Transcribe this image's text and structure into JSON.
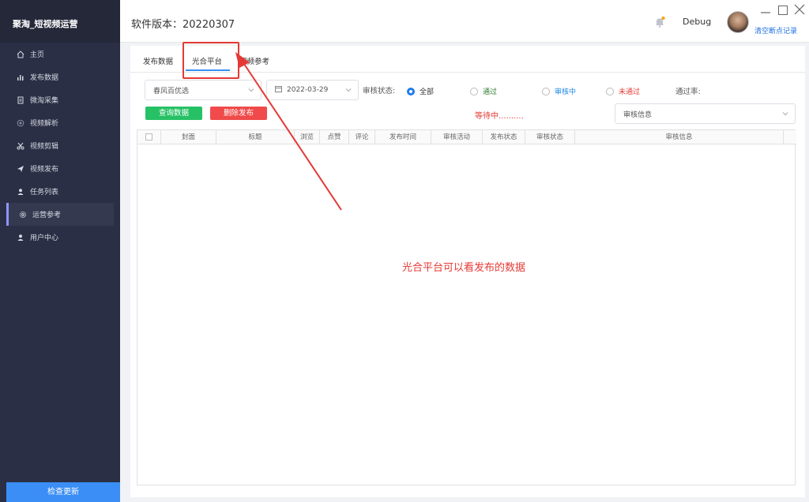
{
  "app": {
    "title": "聚淘_短视频运营",
    "version_label": "软件版本：20220307",
    "user": "Debug",
    "clear_link": "清空断点记录"
  },
  "sidebar": {
    "items": [
      {
        "label": "主页",
        "icon": "home-icon"
      },
      {
        "label": "发布数据",
        "icon": "bar-chart-icon"
      },
      {
        "label": "微淘采集",
        "icon": "document-icon"
      },
      {
        "label": "视频解析",
        "icon": "circle-icon"
      },
      {
        "label": "视频剪辑",
        "icon": "scissors-icon"
      },
      {
        "label": "视频发布",
        "icon": "send-icon"
      },
      {
        "label": "任务列表",
        "icon": "user-icon"
      },
      {
        "label": "运营参考",
        "icon": "gear-icon",
        "active": true
      },
      {
        "label": "用户中心",
        "icon": "user-icon"
      }
    ],
    "update_button": "检查更新"
  },
  "tabs": [
    {
      "label": "发布数据"
    },
    {
      "label": "光合平台",
      "active": true
    },
    {
      "label": "视频参考"
    }
  ],
  "filters": {
    "account": "春风百优选",
    "date": "2022-03-29",
    "status_label": "审核状态:",
    "radios": [
      {
        "label": "全部",
        "checked": true,
        "color": "#333333"
      },
      {
        "label": "通过",
        "checked": false,
        "color": "#2e7d32"
      },
      {
        "label": "审核中",
        "checked": false,
        "color": "#1e88e5"
      },
      {
        "label": "未通过",
        "checked": false,
        "color": "#e53935"
      }
    ],
    "pass_rate_label": "通过率:",
    "query_button": "查询数据",
    "delete_button": "删除发布",
    "waiting_text": "等待中..........",
    "audit_select": "审核信息"
  },
  "table": {
    "columns": [
      "封面",
      "标题",
      "浏览",
      "点赞",
      "评论",
      "发布时间",
      "审核活动",
      "发布状态",
      "审核状态",
      "审核信息"
    ],
    "rows": []
  },
  "annotation": {
    "text": "光合平台可以看发布的数据"
  },
  "colors": {
    "sidebar_bg": "#2b2f45",
    "accent": "#3a8ef5",
    "green": "#26c165",
    "red": "#f04a4a",
    "annotation": "#e53935"
  }
}
